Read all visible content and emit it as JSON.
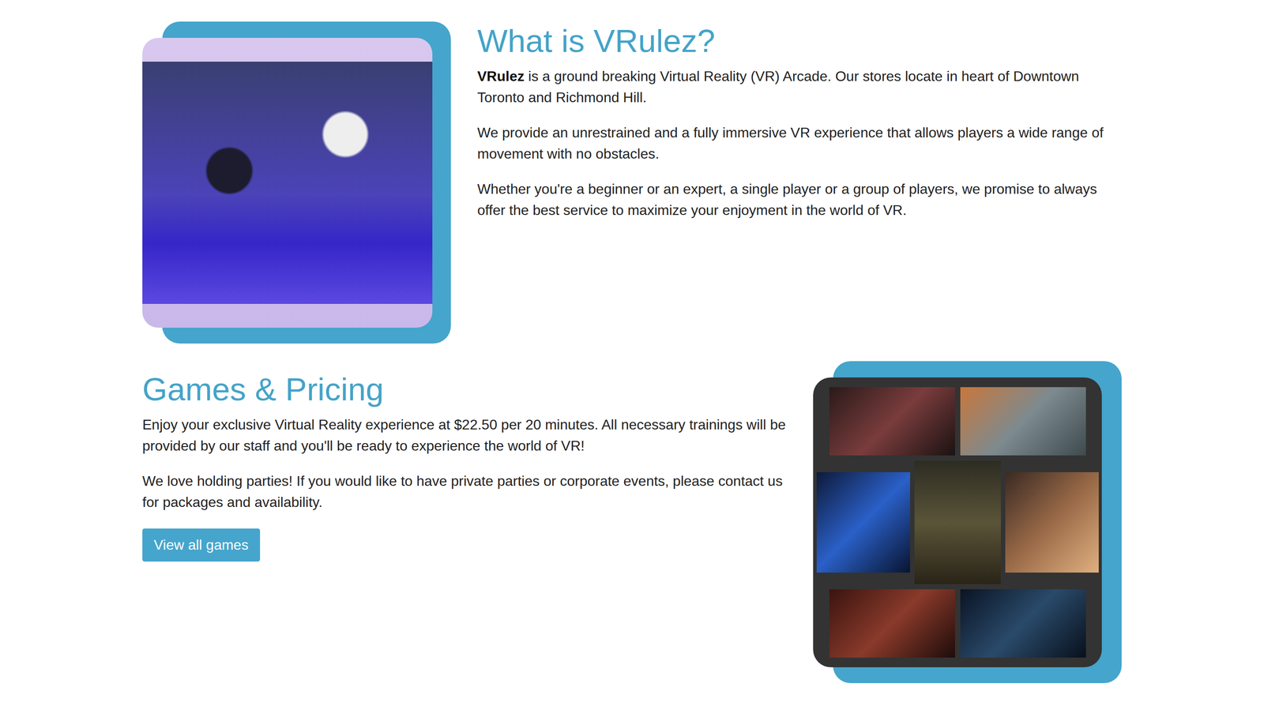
{
  "about": {
    "heading": "What is VRulez?",
    "paragraphs": [
      {
        "bold": "VRulez",
        "text": " is a ground breaking Virtual Reality (VR) Arcade. Our stores locate in heart of Downtown Toronto and Richmond Hill."
      },
      {
        "bold": "",
        "text": "We provide an unrestrained and a fully immersive VR experience that allows players a wide range of movement with no obstacles."
      },
      {
        "bold": "",
        "text": "Whether you're a beginner or an expert, a single player or a group of players, we promise to always offer the best service to maximize your enjoyment in the world of VR."
      }
    ]
  },
  "games": {
    "heading": "Games & Pricing",
    "paragraphs": [
      "Enjoy your exclusive Virtual Reality experience at $22.50 per 20 minutes. All necessary trainings will be provided by our staff and you'll be ready to experience the world of VR!",
      "We love holding parties! If you would like to have private parties or corporate events, please contact us for packages and availability."
    ],
    "button": "View all games"
  }
}
